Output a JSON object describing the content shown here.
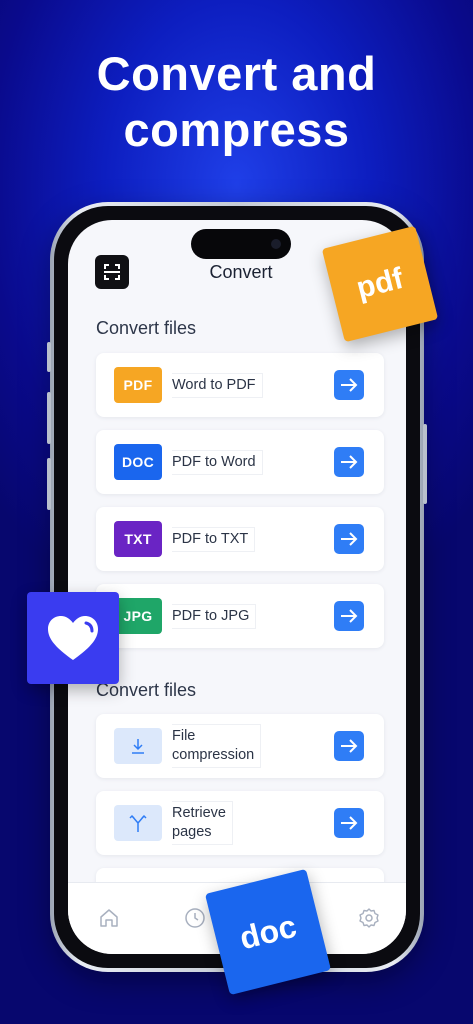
{
  "headline": {
    "line1": "Convert and",
    "line2": "compress"
  },
  "app": {
    "title": "Convert",
    "sections": [
      {
        "title": "Convert files",
        "items": [
          {
            "badge": "PDF",
            "badge_color": "#f6a623",
            "label": "Word to PDF"
          },
          {
            "badge": "DOC",
            "badge_color": "#1a66ee",
            "label": "PDF to Word"
          },
          {
            "badge": "TXT",
            "badge_color": "#6a24c4",
            "label": "PDF to TXT"
          },
          {
            "badge": "JPG",
            "badge_color": "#1fa668",
            "label": "PDF to JPG"
          }
        ]
      },
      {
        "title": "Convert files",
        "items": [
          {
            "icon": "download-icon",
            "label_line1": "File",
            "label_line2": "compression"
          },
          {
            "icon": "split-icon",
            "label_line1": "Retrieve",
            "label_line2": "pages"
          }
        ]
      }
    ],
    "tabs": [
      "home-icon",
      "clock-icon",
      "gear-icon"
    ]
  },
  "stickers": {
    "pdf": "pdf",
    "doc": "doc",
    "heart": "heart-icon"
  },
  "colors": {
    "accent": "#2f7df6",
    "background": "#0d1ec0"
  }
}
